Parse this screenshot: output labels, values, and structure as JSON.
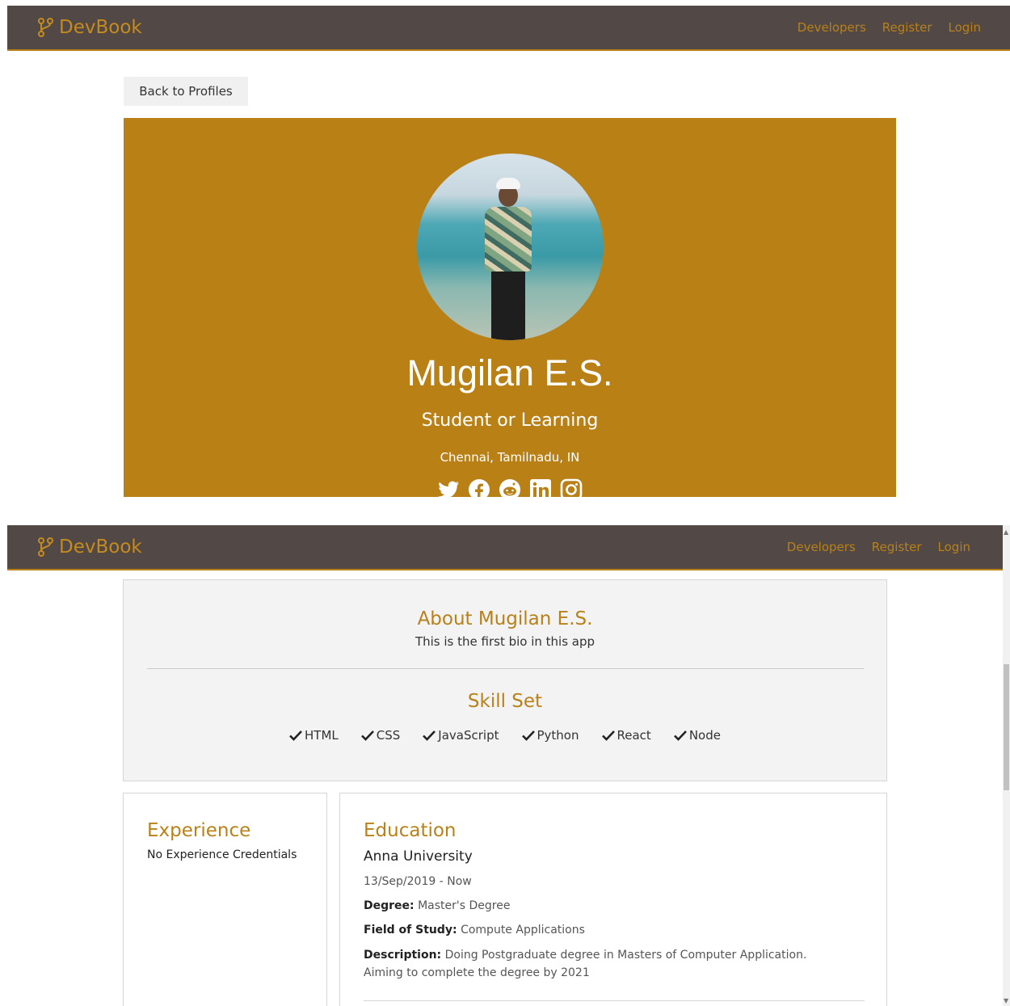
{
  "navbar": {
    "brand": "DevBook",
    "links": [
      "Developers",
      "Register",
      "Login"
    ]
  },
  "back_button": "Back to Profiles",
  "profile": {
    "name": "Mugilan E.S.",
    "status": "Student or Learning",
    "location": "Chennai, Tamilnadu, IN",
    "social_icons": [
      "twitter-icon",
      "facebook-icon",
      "reddit-icon",
      "linkedin-icon",
      "instagram-icon"
    ]
  },
  "about": {
    "title": "About Mugilan E.S.",
    "bio": "This is the first bio in this app",
    "skills_title": "Skill Set",
    "skills": [
      "HTML",
      "CSS",
      "JavaScript",
      "Python",
      "React",
      "Node"
    ]
  },
  "experience": {
    "title": "Experience",
    "empty_text": "No Experience Credentials"
  },
  "education": {
    "title": "Education",
    "school": "Anna University",
    "dates": "13/Sep/2019 - Now",
    "degree_label": "Degree:",
    "degree": "Master's Degree",
    "field_label": "Field of Study:",
    "field": "Compute Applications",
    "description_label": "Description:",
    "description": "Doing Postgraduate degree in Masters of Computer Application. Aiming to complete the degree by 2021"
  },
  "colors": {
    "navbar": "#524845",
    "accent": "#b8811a",
    "profile_bg": "#b98016"
  }
}
